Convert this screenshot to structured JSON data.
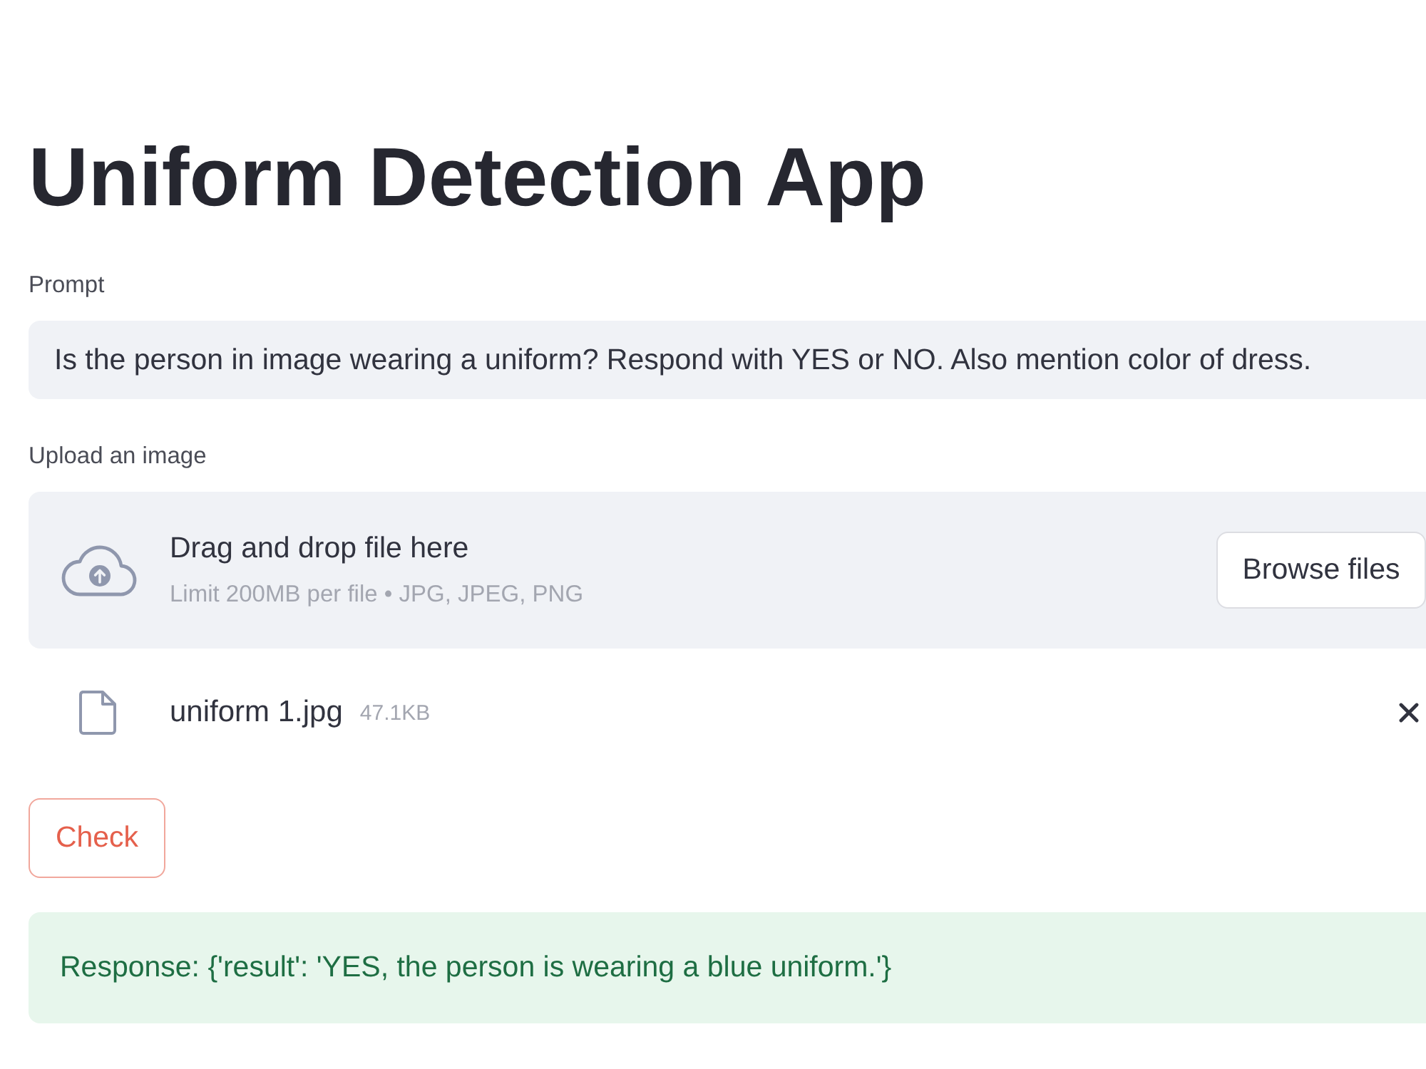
{
  "title": "Uniform Detection App",
  "prompt": {
    "label": "Prompt",
    "value": "Is the person in image wearing a uniform? Respond with YES or NO. Also mention color of dress."
  },
  "uploader": {
    "label": "Upload an image",
    "instruction": "Drag and drop file here",
    "limits": "Limit 200MB per file • JPG, JPEG, PNG",
    "button": "Browse files"
  },
  "files": [
    {
      "name": "uniform 1.jpg",
      "size": "47.1KB"
    }
  ],
  "check_button": "Check",
  "response": {
    "kind": "success",
    "text": "Response: {'result': 'YES, the person is wearing a blue uniform.'}"
  }
}
